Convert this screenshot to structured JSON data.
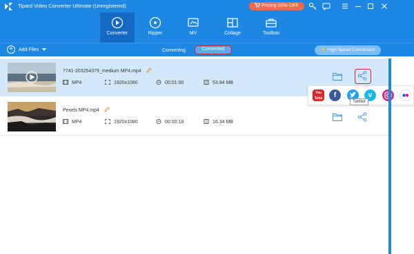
{
  "window": {
    "title": "Tipard Video Converter Ultimate (Unregistered)",
    "pricing_label": "Pricing-20% OFF"
  },
  "nav": {
    "tabs": [
      {
        "label": "Converter",
        "icon": "converter-icon",
        "active": true
      },
      {
        "label": "Ripper",
        "icon": "ripper-icon",
        "active": false
      },
      {
        "label": "MV",
        "icon": "mv-icon",
        "active": false
      },
      {
        "label": "Collage",
        "icon": "collage-icon",
        "active": false
      },
      {
        "label": "Toolbox",
        "icon": "toolbox-icon",
        "active": false
      }
    ]
  },
  "toolbar": {
    "add_files": "Add Files",
    "converting": "Converting",
    "converted": "Converted",
    "high_speed": "High Speed Conversion"
  },
  "files": [
    {
      "name": "7741-203254379_medium MP4.mp4",
      "format": "MP4",
      "resolution": "1920x1080",
      "duration": "00:01:00",
      "size": "53.94 MB"
    },
    {
      "name": "Pexels MP4.mp4",
      "format": "MP4",
      "resolution": "1920x1080",
      "duration": "00:00:18",
      "size": "16.34 MB"
    }
  ],
  "share_popup": {
    "networks": [
      "YouTube",
      "Facebook",
      "Twitter",
      "Vimeo",
      "Instagram",
      "Flickr"
    ],
    "tooltip": "Twitter"
  },
  "colors": {
    "header": "#1e86e3",
    "pricing": "#f36a4a",
    "selected_row": "#d3e9fb",
    "highlight": "#c9242f"
  }
}
